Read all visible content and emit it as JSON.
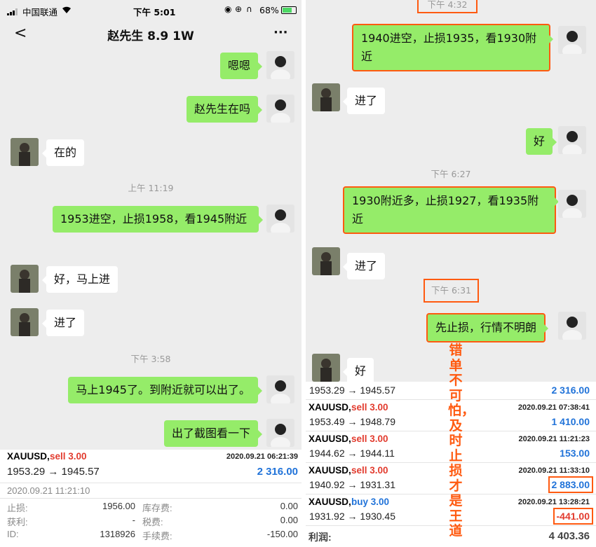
{
  "status": {
    "signal_bars": 3,
    "carrier": "中国联通",
    "time": "下午 5:01",
    "battery": "68%"
  },
  "header": {
    "title": "赵先生 8.9 1W",
    "more": "···"
  },
  "left_chat": [
    {
      "side": "me",
      "text": "嗯嗯"
    },
    {
      "side": "me",
      "text": "赵先生在吗"
    },
    {
      "side": "them",
      "text": "在的"
    },
    {
      "side": "time",
      "text": "上午 11:19"
    },
    {
      "side": "me",
      "text": "1953进空，止损1958，看1945附近"
    },
    {
      "side": "them",
      "text": "好，马上进"
    },
    {
      "side": "them",
      "text": "进了"
    },
    {
      "side": "time",
      "text": "下午 3:58"
    },
    {
      "side": "me",
      "text": "马上1945了。到附近就可以出了。"
    },
    {
      "side": "me",
      "text": "出了截图看一下"
    }
  ],
  "left_trade": {
    "symbol": "XAUUSD,",
    "side": "sell 3.00",
    "close_time": "2020.09.21 06:21:39",
    "prices": "1953.29 → 1945.57",
    "profit": "2 316.00",
    "open_time": "2020.09.21 11:21:10",
    "details": [
      {
        "k1": "止损:",
        "v1": "1956.00",
        "k2": "库存费:",
        "v2": "0.00"
      },
      {
        "k1": "获利:",
        "v1": "-",
        "k2": "税费:",
        "v2": "0.00"
      },
      {
        "k1": "ID:",
        "v1": "1318926",
        "k2": "手续费:",
        "v2": "-150.00"
      }
    ]
  },
  "right_chat": [
    {
      "side": "time",
      "text": "下午 4:32"
    },
    {
      "side": "me",
      "text": "1940进空，止损1935，看1930附近"
    },
    {
      "side": "them",
      "text": "进了"
    },
    {
      "side": "me",
      "text": "好"
    },
    {
      "side": "time",
      "text": "下午 6:27"
    },
    {
      "side": "me",
      "text": "1930附近多，止损1927，看1935附近"
    },
    {
      "side": "them",
      "text": "进了"
    },
    {
      "side": "time",
      "text": "下午 6:31"
    },
    {
      "side": "me",
      "text": "先止损，行情不明朗"
    },
    {
      "side": "them",
      "text": "好"
    }
  ],
  "caption": "错单不可怕，及时止损才是王道",
  "right_trades": [
    {
      "symbol": "",
      "side": "",
      "type": "",
      "time": "",
      "prices": "1953.29 → 1945.57",
      "profit": "2 316.00"
    },
    {
      "symbol": "XAUUSD,",
      "side": "sell 3.00",
      "type": "sell",
      "time": "2020.09.21 07:38:41",
      "prices": "1953.49 → 1948.79",
      "profit": "1 410.00"
    },
    {
      "symbol": "XAUUSD,",
      "side": "sell 3.00",
      "type": "sell",
      "time": "2020.09.21 11:21:23",
      "prices": "1944.62 → 1944.11",
      "profit": "153.00"
    },
    {
      "symbol": "XAUUSD,",
      "side": "sell 3.00",
      "type": "sell",
      "time": "2020.09.21 11:33:10",
      "prices": "1940.92 → 1931.31",
      "profit": "2 883.00"
    },
    {
      "symbol": "XAUUSD,",
      "side": "buy 3.00",
      "type": "buy",
      "time": "2020.09.21 13:28:21",
      "prices": "1931.92 → 1930.45",
      "profit": "-441.00"
    }
  ],
  "total": {
    "label": "利润:",
    "value": "4 403.36"
  },
  "colors": {
    "me_bubble": "#95ec69",
    "highlight": "#ff5a10",
    "profit_blue": "#2173d9",
    "sell_red": "#e23b2e"
  }
}
